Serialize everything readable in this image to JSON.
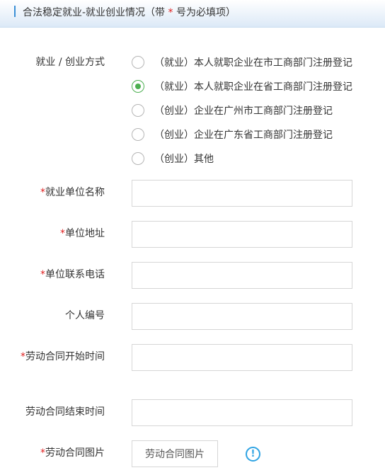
{
  "header": {
    "title_prefix": "合法稳定就业-就业创业情况（带",
    "title_star": "*",
    "title_suffix": "号为必填项）"
  },
  "form": {
    "employment_type": {
      "label": "就业 / 创业方式",
      "options": [
        {
          "label": "（就业）本人就职企业在市工商部门注册登记",
          "checked": false
        },
        {
          "label": "（就业）本人就职企业在省工商部门注册登记",
          "checked": true
        },
        {
          "label": "（创业）企业在广州市工商部门注册登记",
          "checked": false
        },
        {
          "label": "（创业）企业在广东省工商部门注册登记",
          "checked": false
        },
        {
          "label": "（创业）其他",
          "checked": false
        }
      ]
    },
    "fields": [
      {
        "required": "*",
        "label": "就业单位名称",
        "value": ""
      },
      {
        "required": "*",
        "label": "单位地址",
        "value": ""
      },
      {
        "required": "*",
        "label": "单位联系电话",
        "value": ""
      },
      {
        "required": "",
        "label": "个人编号",
        "value": ""
      },
      {
        "required": "*",
        "label": "劳动合同开始时间",
        "value": ""
      },
      {
        "required": "",
        "label": "劳动合同结束时间",
        "value": ""
      }
    ],
    "contract_image": {
      "required": "*",
      "label": "劳动合同图片",
      "button_label": "劳动合同图片",
      "info_icon_glyph": "!"
    }
  },
  "colors": {
    "accent_blue": "#3a8fd6",
    "required_red": "#e02020",
    "radio_green": "#4caf50",
    "info_blue": "#2ea3e3"
  }
}
